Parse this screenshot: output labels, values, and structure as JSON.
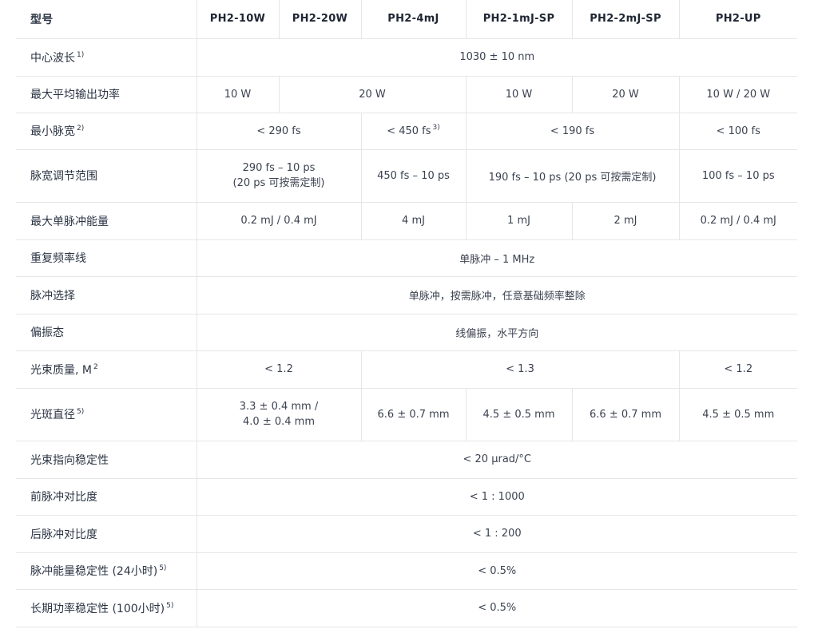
{
  "header": {
    "param": "型号",
    "models": [
      "PH2-10W",
      "PH2-20W",
      "PH2-4mJ",
      "PH2-1mJ-SP",
      "PH2-2mJ-SP",
      "PH2-UP"
    ]
  },
  "rows": {
    "wavelength": {
      "label": "中心波长",
      "note": "1)",
      "value": "1030 ± 10 nm"
    },
    "avg_power": {
      "label": "最大平均输出功率",
      "v1": "10 W",
      "v2": "20 W",
      "v3": "10 W",
      "v4": "20 W",
      "v5": "10 W / 20 W"
    },
    "min_pulse": {
      "label": "最小脉宽",
      "note": "2)",
      "v1": "< 290 fs",
      "v2": "< 450 fs",
      "v2_note": "3)",
      "v3": "< 190 fs",
      "v4": "< 100 fs"
    },
    "pulse_range": {
      "label": "脉宽调节范围",
      "v1_line1": "290 fs – 10 ps",
      "v1_line2": "(20 ps 可按需定制)",
      "v2": "450 fs – 10 ps",
      "v3": "190 fs – 10 ps (20 ps 可按需定制)",
      "v4": "100 fs – 10 ps"
    },
    "pulse_energy": {
      "label": "最大单脉冲能量",
      "v1": "0.2 mJ / 0.4 mJ",
      "v2": "4 mJ",
      "v3": "1 mJ",
      "v4": "2 mJ",
      "v5": "0.2 mJ / 0.4 mJ"
    },
    "rep_rate": {
      "label": "重复频率线",
      "value": "单脉冲 – 1 MHz"
    },
    "pulse_pick": {
      "label": "脉冲选择",
      "value": "单脉冲，按需脉冲，任意基础频率整除"
    },
    "polarization": {
      "label": "偏振态",
      "value": "线偏振，水平方向"
    },
    "beam_quality": {
      "label": "光束质量, M",
      "sup": "2",
      "v1": "< 1.2",
      "v2": "< 1.3",
      "v3": "< 1.2"
    },
    "spot_diameter": {
      "label": "光斑直径",
      "note": "5)",
      "v1_line1": "3.3 ± 0.4 mm /",
      "v1_line2": "4.0 ± 0.4 mm",
      "v2": "6.6 ± 0.7 mm",
      "v3": "4.5 ± 0.5 mm",
      "v4": "6.6 ± 0.7 mm",
      "v5": "4.5 ± 0.5 mm"
    },
    "pointing": {
      "label": "光束指向稳定性",
      "value": "< 20 µrad/°C"
    },
    "pre_contrast": {
      "label": "前脉冲对比度",
      "value": "< 1 : 1000"
    },
    "post_contrast": {
      "label": "后脉冲对比度",
      "value": "< 1 : 200"
    },
    "energy_stability": {
      "label": "脉冲能量稳定性 (24小时)",
      "note": "5)",
      "value": "< 0.5%"
    },
    "power_stability": {
      "label": "长期功率稳定性 (100小时)",
      "note": "5)",
      "value": "< 0.5%"
    }
  }
}
